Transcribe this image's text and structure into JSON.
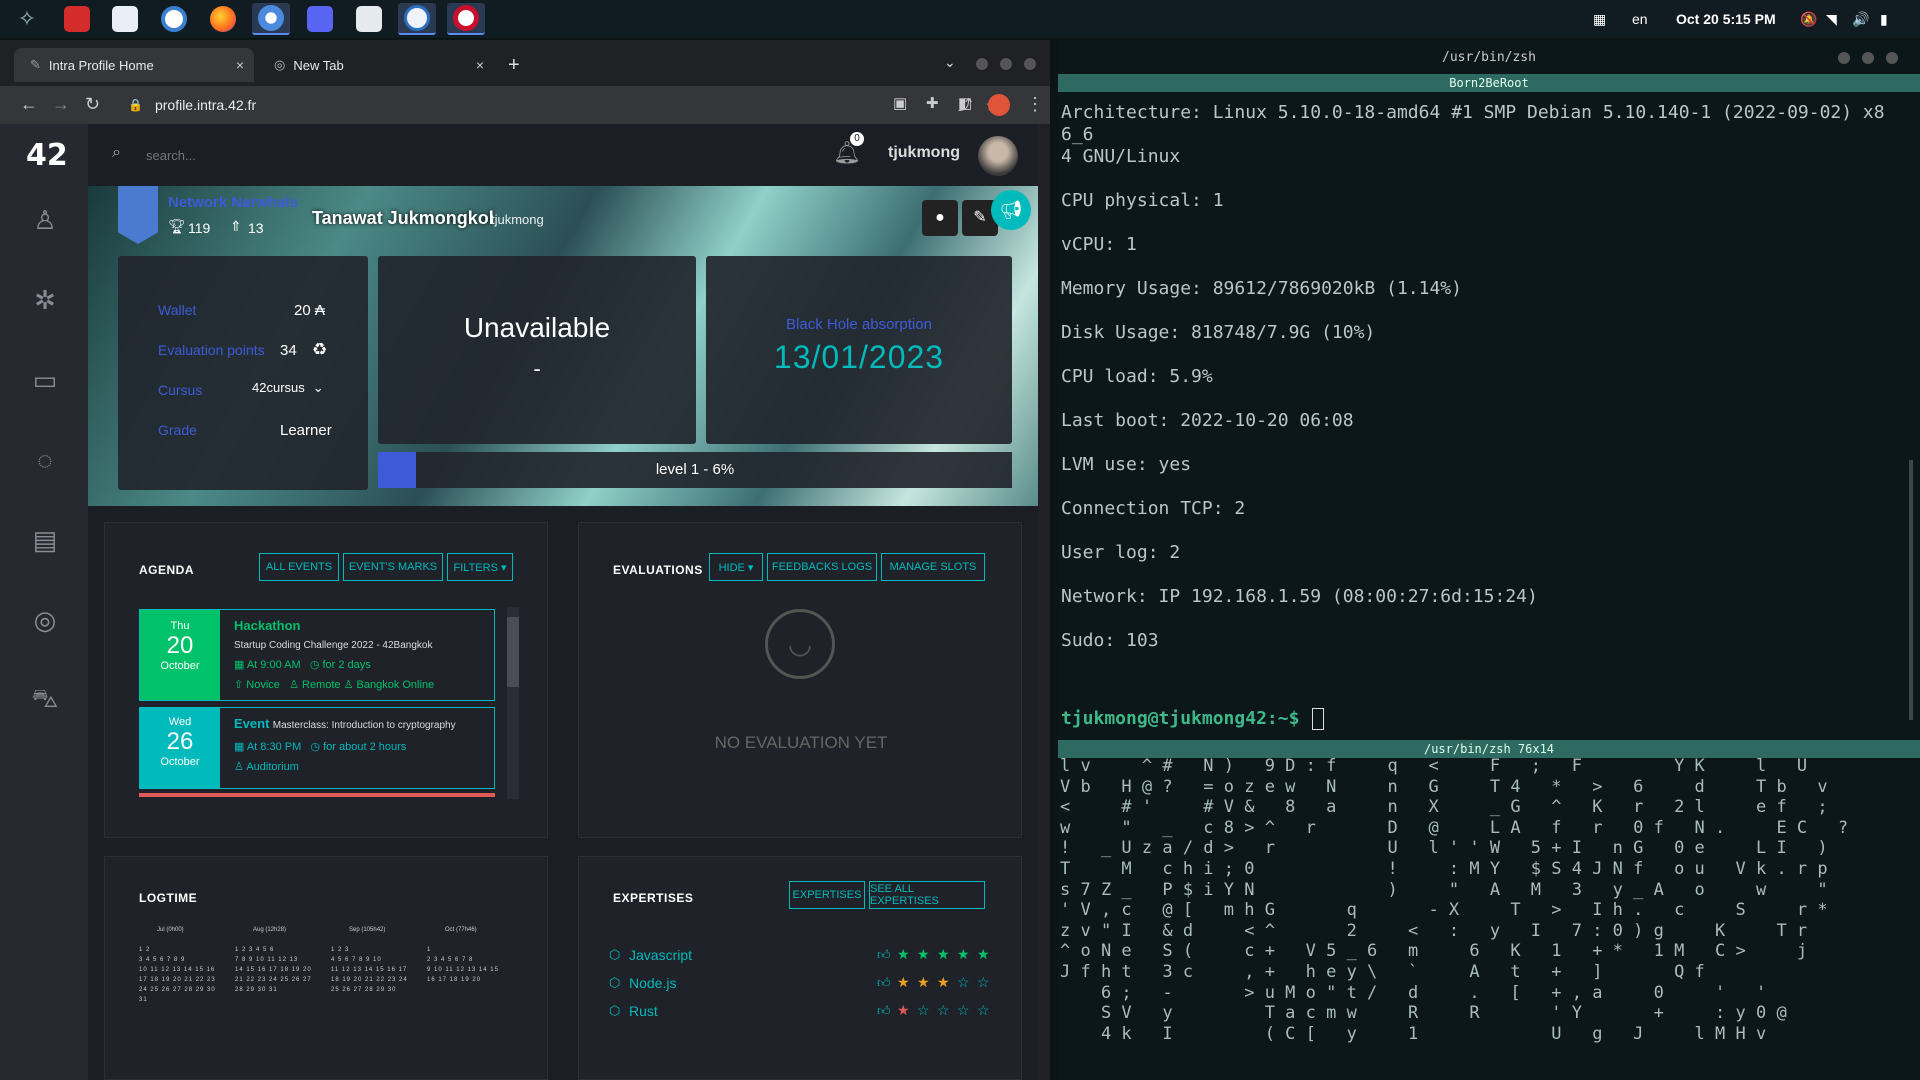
{
  "taskbar": {
    "apps": [
      "app-menu",
      "app-red",
      "files",
      "network-app",
      "firefox",
      "chromium",
      "discord",
      "file-manager",
      "system-monitor",
      "debian-app"
    ],
    "keyboard_layout": "en",
    "datetime": "Oct 20  5:15 PM"
  },
  "browser": {
    "tabs": [
      {
        "label": "Intra Profile Home",
        "close": "×"
      },
      {
        "label": "New Tab",
        "close": "×"
      }
    ],
    "new_tab": "+",
    "url": "profile.intra.42.fr"
  },
  "site": {
    "logo": "42",
    "search_placeholder": "search...",
    "notifications": "0",
    "username": "tjukmong"
  },
  "profile": {
    "coalition": "Network Narwhals",
    "trophies": "119",
    "rank": "13",
    "full_name": "Tanawat Jukmongkol",
    "login": "tjukmong",
    "wallet_label": "Wallet",
    "wallet_value": "20 ₳",
    "eval_label": "Evaluation points",
    "eval_value": "34",
    "cursus_label": "Cursus",
    "cursus_value": "42cursus",
    "grade_label": "Grade",
    "grade_value": "Learner",
    "availability": "Unavailable",
    "availability_sub": "-",
    "blackhole_label": "Black Hole absorption",
    "blackhole_date": "13/01/2023",
    "level_text": "level 1 - 6%",
    "level_progress": 0.06
  },
  "agenda": {
    "title": "AGENDA",
    "buttons": [
      "ALL EVENTS",
      "EVENT'S MARKS",
      "FILTERS ▾"
    ],
    "events": [
      {
        "weekday": "Thu",
        "day": "20",
        "month": "October",
        "name": "Hackathon",
        "desc": "Startup Coding Challenge 2022 - 42Bangkok",
        "time": "At 9:00 AM",
        "duration": "for 2 days",
        "level": "Novice",
        "place1": "Remote",
        "place2": "Bangkok Online"
      },
      {
        "weekday": "Wed",
        "day": "26",
        "month": "October",
        "name": "Event",
        "desc": "Masterclass: Introduction to cryptography",
        "time": "At 8:30 PM",
        "duration": "for about 2 hours",
        "place1": "Auditorium"
      }
    ]
  },
  "evaluations": {
    "title": "EVALUATIONS",
    "buttons": [
      "HIDE ▾",
      "FEEDBACKS LOGS",
      "MANAGE SLOTS"
    ],
    "empty": "NO EVALUATION YET"
  },
  "logtime": {
    "title": "LOGTIME",
    "months": [
      {
        "label": "Jul (0h00)",
        "weeks": [
          "1 2",
          "3 4 5 6 7 8 9",
          "10 11 12 13 14 15 16",
          "17 18 19 20 21 22 23",
          "24 25 26 27 28 29 30",
          "31"
        ]
      },
      {
        "label": "Aug (12h28)",
        "weeks": [
          "1 2 3 4 5 6",
          "7 8 9 10 11 12 13",
          "14 15 16 17 18 19 20",
          "21 22 23 24 25 26 27",
          "28 29 30 31"
        ]
      },
      {
        "label": "Sep (105h42)",
        "weeks": [
          "1 2 3",
          "4 5 6 7 8 9 10",
          "11 12 13 14 15 16 17",
          "18 19 20 21 22 23 24",
          "25 26 27 28 29 30"
        ]
      },
      {
        "label": "Oct (77h46)",
        "weeks": [
          "1",
          "2 3 4 5 6 7 8",
          "9 10 11 12 13 14 15",
          "16 17 18 19 20"
        ]
      }
    ]
  },
  "expertises": {
    "title": "EXPERTISES",
    "buttons": [
      "EXPERTISES",
      "SEE ALL EXPERTISES"
    ],
    "items": [
      {
        "name": "Javascript",
        "stars": 5
      },
      {
        "name": "Node.js",
        "stars": 3
      },
      {
        "name": "Rust",
        "stars": 1
      }
    ]
  },
  "terminal": {
    "title": "/usr/bin/zsh",
    "pane1_title": "Born2BeRoot",
    "lines": [
      "Architecture: Linux 5.10.0-18-amd64 #1 SMP Debian 5.10.140-1 (2022-09-02) x8",
      "6_6",
      "4 GNU/Linux",
      "",
      "CPU physical: 1",
      "",
      "vCPU: 1",
      "",
      "Memory Usage: 89612/7869020kB (1.14%)",
      "",
      "Disk Usage: 818748/7.9G (10%)",
      "",
      "CPU load: 5.9%",
      "",
      "Last boot: 2022-10-20 06:08",
      "",
      "LVM use: yes",
      "",
      "Connection TCP: 2",
      "",
      "User log: 2",
      "",
      "Network: IP 192.168.1.59 (08:00:27:6d:15:24)",
      "",
      "Sudo: 103"
    ],
    "prompt": "tjukmong@tjukmong42:~$ ",
    "pane2_title": "/usr/bin/zsh 76x14",
    "rain": [
      "l v     ^ #   N )   9 D : f     q   <     F   ;   F         Y K     l   U",
      "V b   H @ ?   = o z e w   N     n   G     T 4   *   >   6     d     T b   v",
      "<     # '     # V &   8   a     n   X     _ G   ^   K   r   2 l     e f   ;",
      "w     \"   _   c 8 > ^   r       D   @     L A   f   r   0 f   N .     E C   ?",
      "!   _ U z a / d >   r           U   l ' ' W   5 + I   n G   0 e     L I   )",
      "T     M   c h i ; 0             !     : M Y   $ S 4 J N f   o u   V k . r p",
      "s 7 Z _   P $ i Y N             )     \"   A   M   3   y _ A   o     w     \"",
      "' V , c   @ [   m h G       q       - X     T   >   I h .   c     S     r *",
      "z v \" I   & d     < ^       2     <   :   y   I   7 : 0 ) g     K     T r",
      "^ o N e   S (     c +   V 5 _ 6   m     6   K   1   + *   1 M   C >     j",
      "J f h t   3 c     , +   h e y \\   `     A   t   +   ]       Q f",
      "    6 ;   -       > u M o \" t /   d     .   [   + , a     0     '   '",
      "    S V   y         T a c m w     R     R       ' Y       +     : y 0 @",
      "    4 k   I         ( C [   y     1             U   g   J     l M H v"
    ]
  }
}
